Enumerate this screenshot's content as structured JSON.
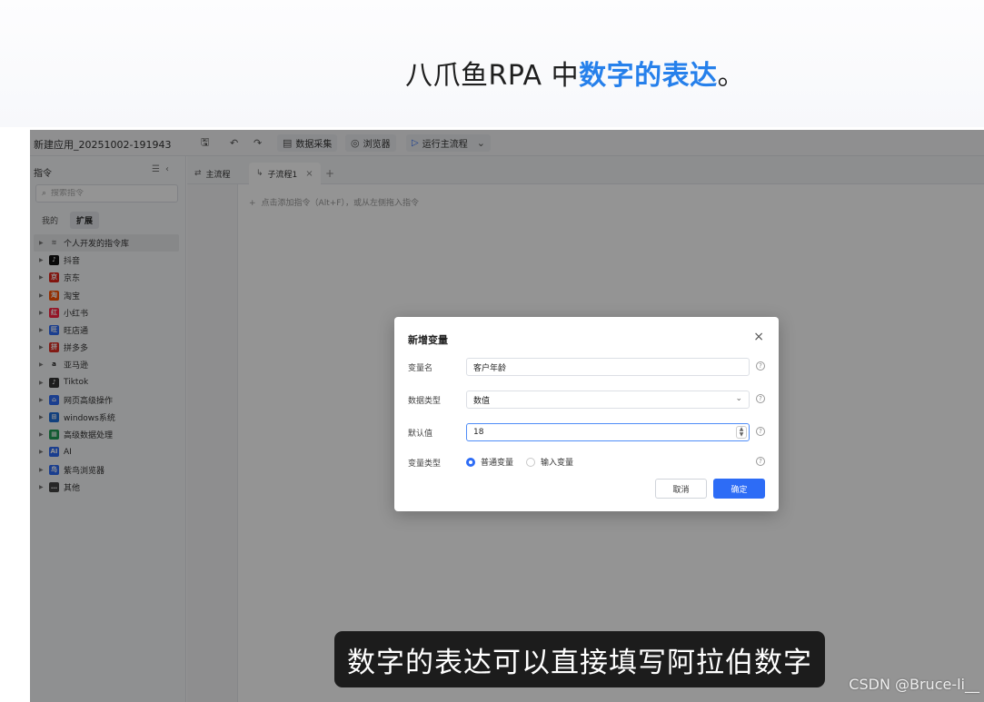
{
  "banner": {
    "title_plain": "八爪鱼RPA 中",
    "title_highlight": "数字的表达",
    "title_suffix": "。"
  },
  "app": {
    "name": "新建应用_20251002-191943",
    "toolbar": {
      "data_collect": "数据采集",
      "browser": "浏览器",
      "run": "运行主流程"
    }
  },
  "sidebar": {
    "title": "指令",
    "search_placeholder": "搜索指令",
    "tabs": [
      "我的",
      "扩展"
    ],
    "items": [
      {
        "label": "个人开发的指令库",
        "icon": "layers-icon",
        "color": "#777777"
      },
      {
        "label": "抖音",
        "icon": "douyin-icon",
        "color": "#111111"
      },
      {
        "label": "京东",
        "icon": "jd-icon",
        "color": "#e1251b"
      },
      {
        "label": "淘宝",
        "icon": "taobao-icon",
        "color": "#ff5000"
      },
      {
        "label": "小红书",
        "icon": "xiaohongshu-icon",
        "color": "#ff2442"
      },
      {
        "label": "旺店通",
        "icon": "wangdiantong-icon",
        "color": "#2d6cf6"
      },
      {
        "label": "拼多多",
        "icon": "pinduoduo-icon",
        "color": "#e02e24"
      },
      {
        "label": "亚马逊",
        "icon": "amazon-icon",
        "color": "#222222"
      },
      {
        "label": "Tiktok",
        "icon": "tiktok-icon",
        "color": "#333333"
      },
      {
        "label": "网页高级操作",
        "icon": "web-icon",
        "color": "#2d6cf6"
      },
      {
        "label": "windows系统",
        "icon": "windows-icon",
        "color": "#1e6fd9"
      },
      {
        "label": "高级数据处理",
        "icon": "data-icon",
        "color": "#1f9d55"
      },
      {
        "label": "AI",
        "icon": "ai-icon",
        "color": "#2d6cf6"
      },
      {
        "label": "紫鸟浏览器",
        "icon": "ziniao-icon",
        "color": "#2d6cf6"
      },
      {
        "label": "其他",
        "icon": "more-icon",
        "color": "#444444"
      }
    ]
  },
  "tabs": {
    "main": "主流程",
    "sub": "子流程1"
  },
  "editor": {
    "hint": "点击添加指令（Alt+F），或从左侧拖入指令"
  },
  "dialog": {
    "title": "新增变量",
    "name_label": "变量名",
    "name_value": "客户年龄",
    "type_label": "数据类型",
    "type_value": "数值",
    "default_label": "默认值",
    "default_value": "18",
    "kind_label": "变量类型",
    "kind_option_1": "普通变量",
    "kind_option_2": "输入变量",
    "cancel": "取消",
    "ok": "确定"
  },
  "subtitle": "数字的表达可以直接填写阿拉伯数字",
  "watermark": "CSDN @Bruce-li__"
}
